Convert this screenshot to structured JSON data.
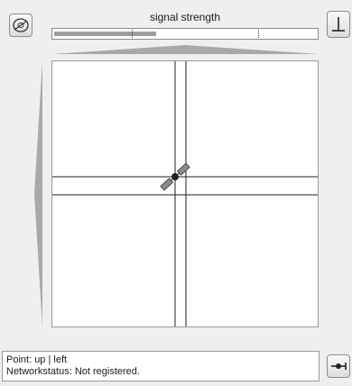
{
  "signal": {
    "label": "signal strength",
    "level": 0.39
  },
  "status": {
    "point_prefix": "Point: ",
    "point_value": "up | left",
    "network_prefix": "Networkstatus: ",
    "network_value": "Not registered."
  },
  "icons": {
    "target_button": "target-icon",
    "antenna_button": "antenna-icon",
    "connect_button": "connector-icon",
    "satellite": "satellite-icon"
  },
  "colors": {
    "signal_fill": "#9e9e9e",
    "wedge": "#a9a9a9",
    "crosshair": "#1f1f1f"
  }
}
